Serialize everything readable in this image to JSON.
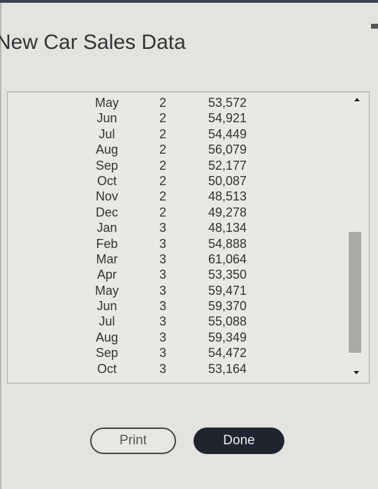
{
  "dialog": {
    "title": "New Car Sales Data"
  },
  "table": {
    "rows": [
      {
        "month": "May",
        "year": "2",
        "sales": "53,572"
      },
      {
        "month": "Jun",
        "year": "2",
        "sales": "54,921"
      },
      {
        "month": "Jul",
        "year": "2",
        "sales": "54,449"
      },
      {
        "month": "Aug",
        "year": "2",
        "sales": "56,079"
      },
      {
        "month": "Sep",
        "year": "2",
        "sales": "52,177"
      },
      {
        "month": "Oct",
        "year": "2",
        "sales": "50,087"
      },
      {
        "month": "Nov",
        "year": "2",
        "sales": "48,513"
      },
      {
        "month": "Dec",
        "year": "2",
        "sales": "49,278"
      },
      {
        "month": "Jan",
        "year": "3",
        "sales": "48,134"
      },
      {
        "month": "Feb",
        "year": "3",
        "sales": "54,888"
      },
      {
        "month": "Mar",
        "year": "3",
        "sales": "61,064"
      },
      {
        "month": "Apr",
        "year": "3",
        "sales": "53,350"
      },
      {
        "month": "May",
        "year": "3",
        "sales": "59,471"
      },
      {
        "month": "Jun",
        "year": "3",
        "sales": "59,370"
      },
      {
        "month": "Jul",
        "year": "3",
        "sales": "55,088"
      },
      {
        "month": "Aug",
        "year": "3",
        "sales": "59,349"
      },
      {
        "month": "Sep",
        "year": "3",
        "sales": "54,472"
      },
      {
        "month": "Oct",
        "year": "3",
        "sales": "53,164"
      }
    ],
    "scroll": {
      "up_icon": "triangle-up-icon",
      "down_icon": "triangle-down-icon"
    }
  },
  "buttons": {
    "print_label": "Print",
    "done_label": "Done"
  }
}
